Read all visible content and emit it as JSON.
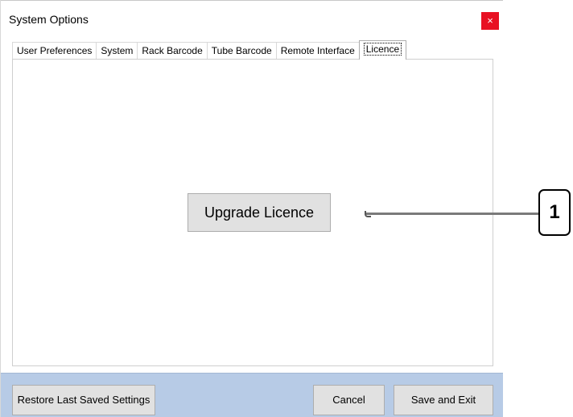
{
  "window": {
    "title": "System Options",
    "close_glyph": "×"
  },
  "tabs": [
    {
      "label": "User Preferences",
      "active": false
    },
    {
      "label": "System",
      "active": false
    },
    {
      "label": "Rack Barcode",
      "active": false
    },
    {
      "label": "Tube Barcode",
      "active": false
    },
    {
      "label": "Remote Interface",
      "active": false
    },
    {
      "label": "Licence",
      "active": true
    }
  ],
  "panel": {
    "upgrade_label": "Upgrade Licence"
  },
  "footer": {
    "restore_label": "Restore Last Saved Settings",
    "cancel_label": "Cancel",
    "save_exit_label": "Save and Exit"
  },
  "callout": {
    "number": "1"
  },
  "colors": {
    "close_bg": "#e81123",
    "footer_bg": "#b7cbe6",
    "button_bg": "#e1e1e1"
  }
}
